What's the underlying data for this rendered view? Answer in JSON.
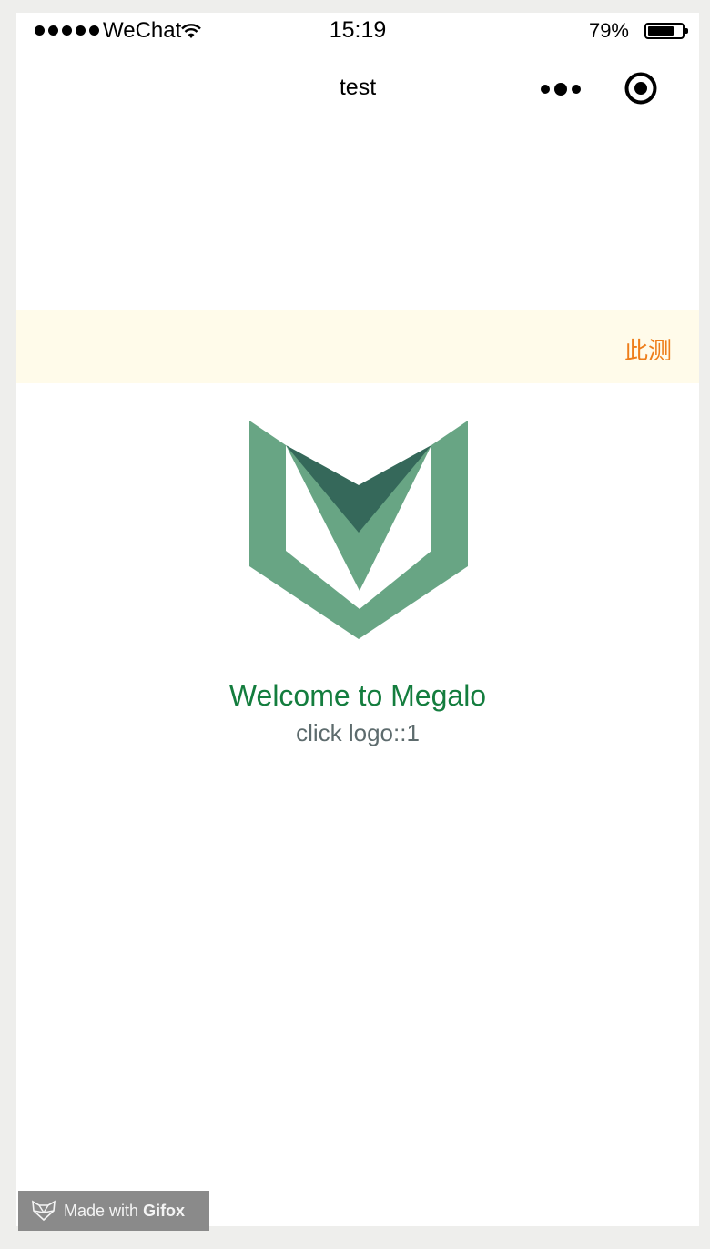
{
  "status_bar": {
    "carrier": "WeChat",
    "time": "15:19",
    "battery_percent": "79%",
    "battery_level": 0.79
  },
  "nav": {
    "title": "test"
  },
  "notice": {
    "text": "此测"
  },
  "main": {
    "welcome": "Welcome to Megalo",
    "counter": "click logo::1"
  },
  "watermark": {
    "prefix": "Made with",
    "brand": "Gifox"
  },
  "colors": {
    "logo_light": "#68a584",
    "logo_dark": "#35685a",
    "welcome_text": "#147d3e",
    "notice_bg": "#fffbea",
    "notice_text": "#ee7d1a"
  }
}
